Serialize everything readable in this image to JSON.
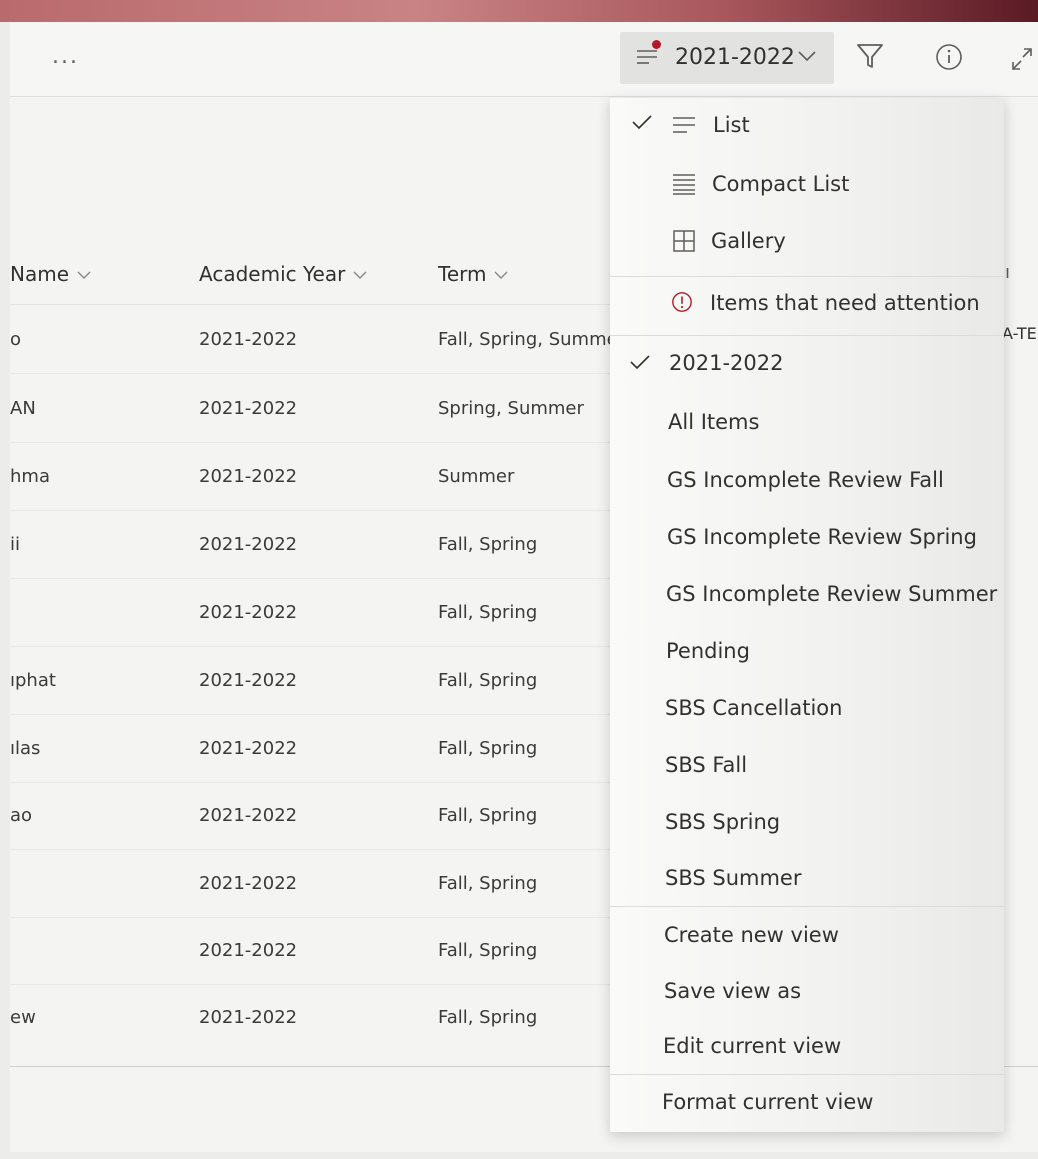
{
  "commandbar": {
    "more_label": "...",
    "current_view": "2021-2022"
  },
  "table": {
    "columns": [
      "Name",
      "Academic Year",
      "Term"
    ],
    "rows": [
      [
        "o",
        "2021-2022",
        "Fall, Spring, Summer"
      ],
      [
        "AN",
        "2021-2022",
        "Spring, Summer"
      ],
      [
        "hma",
        "2021-2022",
        "Summer"
      ],
      [
        "ii",
        "2021-2022",
        "Fall, Spring"
      ],
      [
        "",
        "2021-2022",
        "Fall, Spring"
      ],
      [
        "ıphat",
        "2021-2022",
        "Fall, Spring"
      ],
      [
        "ılas",
        "2021-2022",
        "Fall, Spring"
      ],
      [
        "ao",
        "2021-2022",
        "Fall, Spring"
      ],
      [
        "",
        "2021-2022",
        "Fall, Spring"
      ],
      [
        "",
        "2021-2022",
        "Fall, Spring"
      ],
      [
        "ew",
        "2021-2022",
        "Fall, Spring"
      ]
    ],
    "right_header_partial": "ı",
    "right_cell_partial": "A-TE"
  },
  "view_menu": {
    "layouts": [
      {
        "label": "List",
        "icon": "list-icon",
        "checked": true
      },
      {
        "label": "Compact List",
        "icon": "compact-list-icon",
        "checked": false
      },
      {
        "label": "Gallery",
        "icon": "gallery-icon",
        "checked": false
      }
    ],
    "attention": {
      "label": "Items that need attention",
      "icon": "attention-icon"
    },
    "views": [
      {
        "label": "2021-2022",
        "checked": true
      },
      {
        "label": "All Items",
        "checked": false
      },
      {
        "label": "GS Incomplete Review Fall",
        "checked": false
      },
      {
        "label": "GS Incomplete Review Spring",
        "checked": false
      },
      {
        "label": "GS Incomplete Review Summer",
        "checked": false
      },
      {
        "label": "Pending",
        "checked": false
      },
      {
        "label": "SBS Cancellation",
        "checked": false
      },
      {
        "label": "SBS Fall",
        "checked": false
      },
      {
        "label": "SBS Spring",
        "checked": false
      },
      {
        "label": "SBS Summer",
        "checked": false
      }
    ],
    "actions": [
      "Create new view",
      "Save view as",
      "Edit current view",
      "Format current view"
    ]
  },
  "colors": {
    "accent_dot": "#b3182a",
    "menu_bg": "#f7f7f6",
    "selector_bg": "#e2e2e1"
  }
}
